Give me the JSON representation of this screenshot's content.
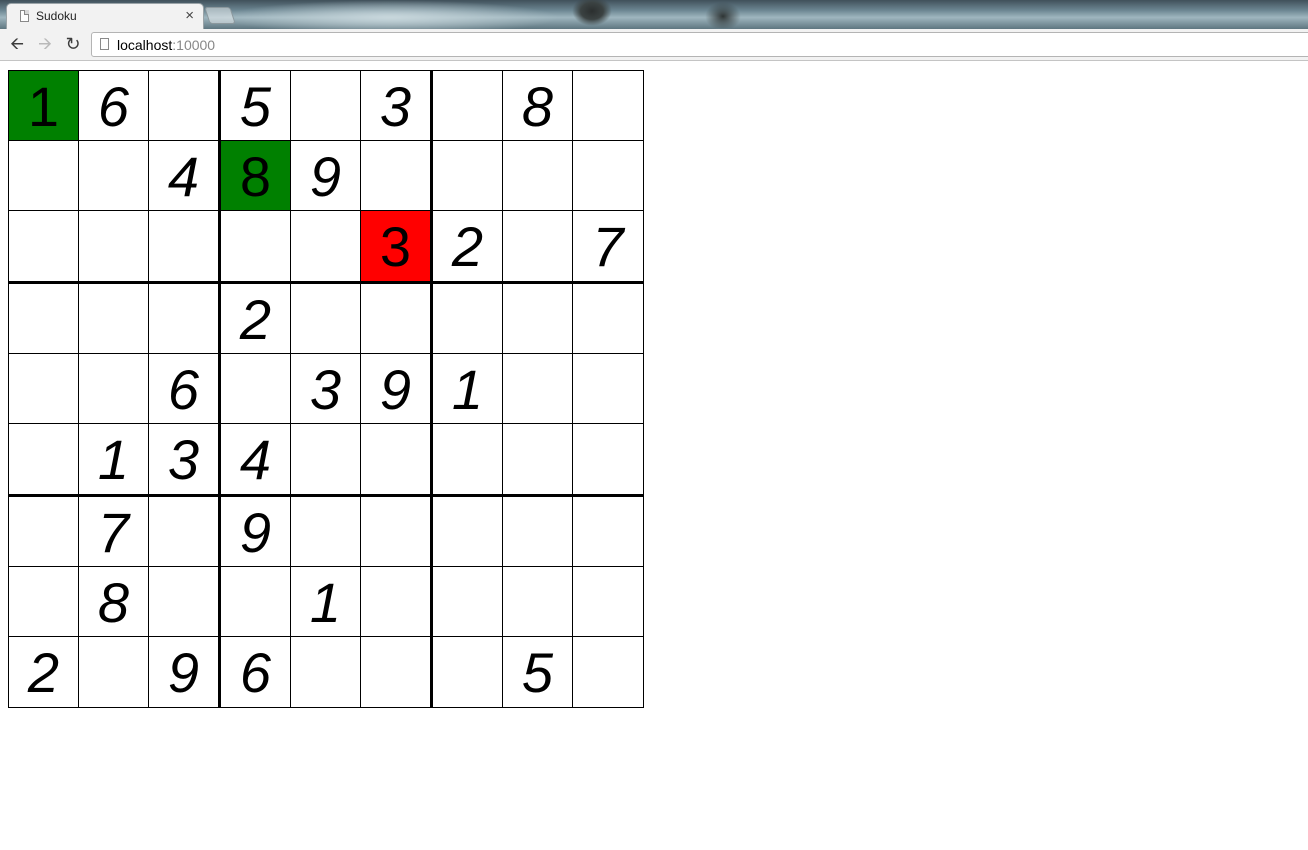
{
  "browser": {
    "tab_title": "Sudoku",
    "close_label": "×",
    "url_host": "localhost",
    "url_port": ":10000"
  },
  "board": {
    "rows": [
      [
        "1",
        "6",
        "",
        "5",
        "",
        "3",
        "",
        "8",
        ""
      ],
      [
        "",
        "",
        "4",
        "8",
        "9",
        "",
        "",
        "",
        ""
      ],
      [
        "",
        "",
        "",
        "",
        "",
        "3",
        "2",
        "",
        "7"
      ],
      [
        "",
        "",
        "",
        "2",
        "",
        "",
        "",
        "",
        ""
      ],
      [
        "",
        "",
        "6",
        "",
        "3",
        "9",
        "1",
        "",
        ""
      ],
      [
        "",
        "1",
        "3",
        "4",
        "",
        "",
        "",
        "",
        ""
      ],
      [
        "",
        "7",
        "",
        "9",
        "",
        "",
        "",
        "",
        ""
      ],
      [
        "",
        "8",
        "",
        "",
        "1",
        "",
        "",
        "",
        ""
      ],
      [
        "2",
        "",
        "9",
        "6",
        "",
        "",
        "",
        "5",
        ""
      ]
    ],
    "highlights": [
      {
        "row": 0,
        "col": 0,
        "color": "#008000"
      },
      {
        "row": 1,
        "col": 3,
        "color": "#008000"
      },
      {
        "row": 2,
        "col": 5,
        "color": "#ff0000"
      }
    ]
  }
}
